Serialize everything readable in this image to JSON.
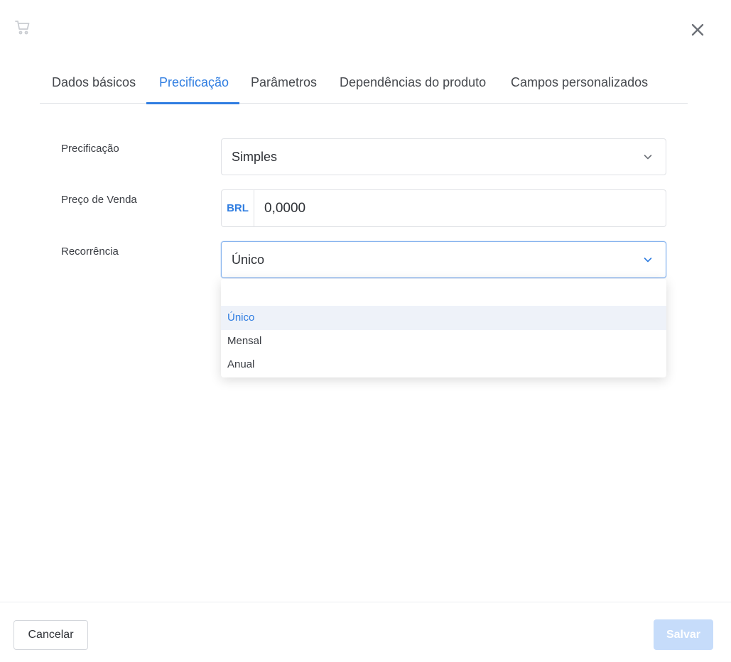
{
  "header": {
    "icon": "cart-icon",
    "close_icon": "close-icon"
  },
  "tabs": [
    {
      "label": "Dados básicos",
      "active": false
    },
    {
      "label": "Precificação",
      "active": true
    },
    {
      "label": "Parâmetros",
      "active": false
    },
    {
      "label": "Dependências do produto",
      "active": false
    },
    {
      "label": "Campos personalizados",
      "active": false
    }
  ],
  "form": {
    "pricing": {
      "label": "Precificação",
      "value": "Simples"
    },
    "price": {
      "label": "Preço de Venda",
      "currency": "BRL",
      "value": "0,0000"
    },
    "recurrence": {
      "label": "Recorrência",
      "value": "Único",
      "options": [
        "Único",
        "Mensal",
        "Anual"
      ],
      "selected_index": 0
    }
  },
  "footer": {
    "cancel_label": "Cancelar",
    "save_label": "Salvar"
  },
  "colors": {
    "accent": "#2f7de1",
    "save_disabled": "#c6dcfa",
    "selected_option_bg": "#eef2f9"
  }
}
